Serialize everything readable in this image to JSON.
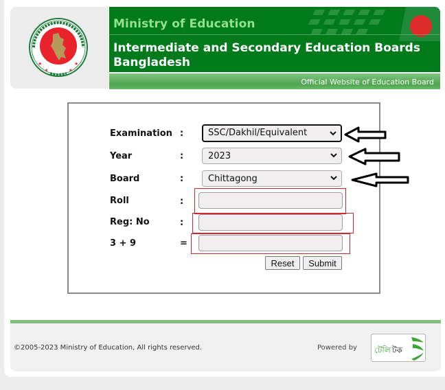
{
  "header": {
    "ministry_title": "Ministry of Education",
    "boards_title": "Intermediate and Secondary Education Boards Bangladesh",
    "subtitle": "Official Website of Education Board",
    "seal_icon": "government-seal-icon",
    "flag_icon": "bangladesh-flag-icon",
    "colors": {
      "header_green": "#007a1b",
      "ministry_text": "#93e08d",
      "seal_red": "#e8232b"
    }
  },
  "form": {
    "fields": [
      {
        "label": "Examination",
        "separator": ":",
        "type": "select",
        "value": "SSC/Dakhil/Equivalent"
      },
      {
        "label": "Year",
        "separator": ":",
        "type": "select",
        "value": "2023"
      },
      {
        "label": "Board",
        "separator": ":",
        "type": "select",
        "value": "Chittagong"
      },
      {
        "label": "Roll",
        "separator": ":",
        "type": "text",
        "value": ""
      },
      {
        "label": "Reg: No",
        "separator": ":",
        "type": "text",
        "value": ""
      },
      {
        "label": "3 + 9",
        "separator": "=",
        "type": "text",
        "value": ""
      }
    ],
    "reset_label": "Reset",
    "submit_label": "Submit",
    "annotation_color": "#d7262b"
  },
  "footer": {
    "copyright": "©2005-2023 Ministry of Education, All rights reserved.",
    "powered_by": "Powered by",
    "vendor_logo": "teletalk-logo-icon",
    "vendor_logo_text": "টেলিটক"
  }
}
